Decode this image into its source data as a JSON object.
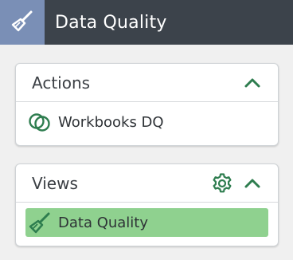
{
  "header": {
    "title": "Data Quality",
    "logo_icon": "broom-icon"
  },
  "colors": {
    "header_bg": "#3c434b",
    "logo_bg": "#7a8fb6",
    "accent_green": "#2e7d4f",
    "selected_bg": "#8fd18f"
  },
  "actions_panel": {
    "title": "Actions",
    "collapse_icon": "chevron-up-icon",
    "items": [
      {
        "label": "Workbooks DQ",
        "icon": "overlapping-circles-icon"
      }
    ]
  },
  "views_panel": {
    "title": "Views",
    "settings_icon": "gear-icon",
    "collapse_icon": "chevron-up-icon",
    "items": [
      {
        "label": "Data Quality",
        "icon": "broom-icon",
        "selected": true
      }
    ]
  }
}
